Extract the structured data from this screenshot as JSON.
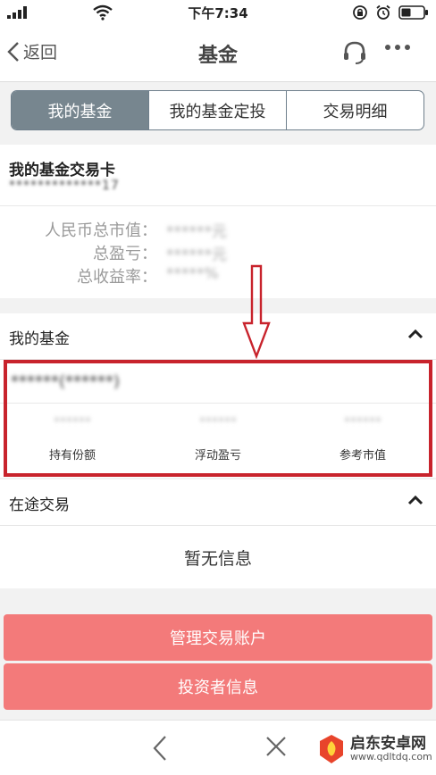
{
  "status_bar": {
    "time": "下午7:34",
    "icons": [
      "signal-icon",
      "wifi-icon",
      "orientation-lock-icon",
      "alarm-icon",
      "battery-icon"
    ]
  },
  "nav": {
    "back_label": "返回",
    "title": "基金",
    "icons": [
      "chevron-left-icon",
      "headset-icon",
      "more-icon"
    ]
  },
  "tabs": [
    {
      "label": "我的基金",
      "active": true
    },
    {
      "label": "我的基金定投",
      "active": false
    },
    {
      "label": "交易明细",
      "active": false
    }
  ],
  "card": {
    "title": "我的基金交易卡",
    "number": "*************17",
    "summary": [
      {
        "label": "人民币总市值：",
        "value": "******元"
      },
      {
        "label": "总盈亏：",
        "value": "******元"
      },
      {
        "label": "总收益率：",
        "value": "*****%"
      }
    ]
  },
  "my_funds": {
    "section_title": "我的基金",
    "fund_name": "******(******)",
    "columns": [
      {
        "label": "持有份额",
        "value": "******"
      },
      {
        "label": "浮动盈亏",
        "value": "******"
      },
      {
        "label": "参考市值",
        "value": "******"
      }
    ]
  },
  "transit": {
    "section_title": "在途交易",
    "empty_text": "暂无信息"
  },
  "buttons": {
    "manage_accounts": "管理交易账户",
    "investor_info": "投资者信息"
  },
  "watermark": {
    "line1": "启东安卓网",
    "line2": "www.qdltdq.com"
  },
  "colors": {
    "tab_active_bg": "#77868f",
    "button_bg": "#f37a7a",
    "highlight": "#c8232c"
  }
}
